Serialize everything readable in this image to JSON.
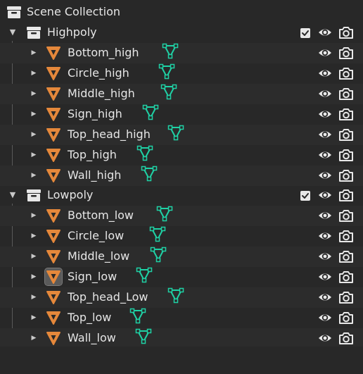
{
  "root": {
    "label": "Scene Collection",
    "icon": "scene-collection-icon"
  },
  "collections": [
    {
      "label": "Highpoly",
      "checked": true,
      "children": [
        {
          "label": "Bottom_high",
          "selected": false
        },
        {
          "label": "Circle_high",
          "selected": false
        },
        {
          "label": "Middle_high",
          "selected": false
        },
        {
          "label": "Sign_high",
          "selected": false
        },
        {
          "label": "Top_head_high",
          "selected": false
        },
        {
          "label": "Top_high",
          "selected": false
        },
        {
          "label": "Wall_high",
          "selected": false
        }
      ]
    },
    {
      "label": "Lowpoly",
      "checked": true,
      "children": [
        {
          "label": "Bottom_low",
          "selected": false
        },
        {
          "label": "Circle_low",
          "selected": false
        },
        {
          "label": "Middle_low",
          "selected": false
        },
        {
          "label": "Sign_low",
          "selected": true
        },
        {
          "label": "Top_head_Low",
          "selected": false
        },
        {
          "label": "Top_low",
          "selected": false
        },
        {
          "label": "Wall_low",
          "selected": false
        }
      ]
    }
  ],
  "icons": {
    "object": "mesh-object-icon",
    "mesh_data": "mesh-data-icon",
    "collection": "collection-icon",
    "visibility": "eye-icon",
    "render": "camera-icon",
    "checkbox": "checkbox-icon"
  },
  "colors": {
    "background": "#282828",
    "row_alt": "#2c2c2c",
    "text": "#e6e6e6",
    "object_icon": "#e5883b",
    "mesh_icon": "#1fd1a5",
    "selected_bg": "#5a5a5a"
  }
}
